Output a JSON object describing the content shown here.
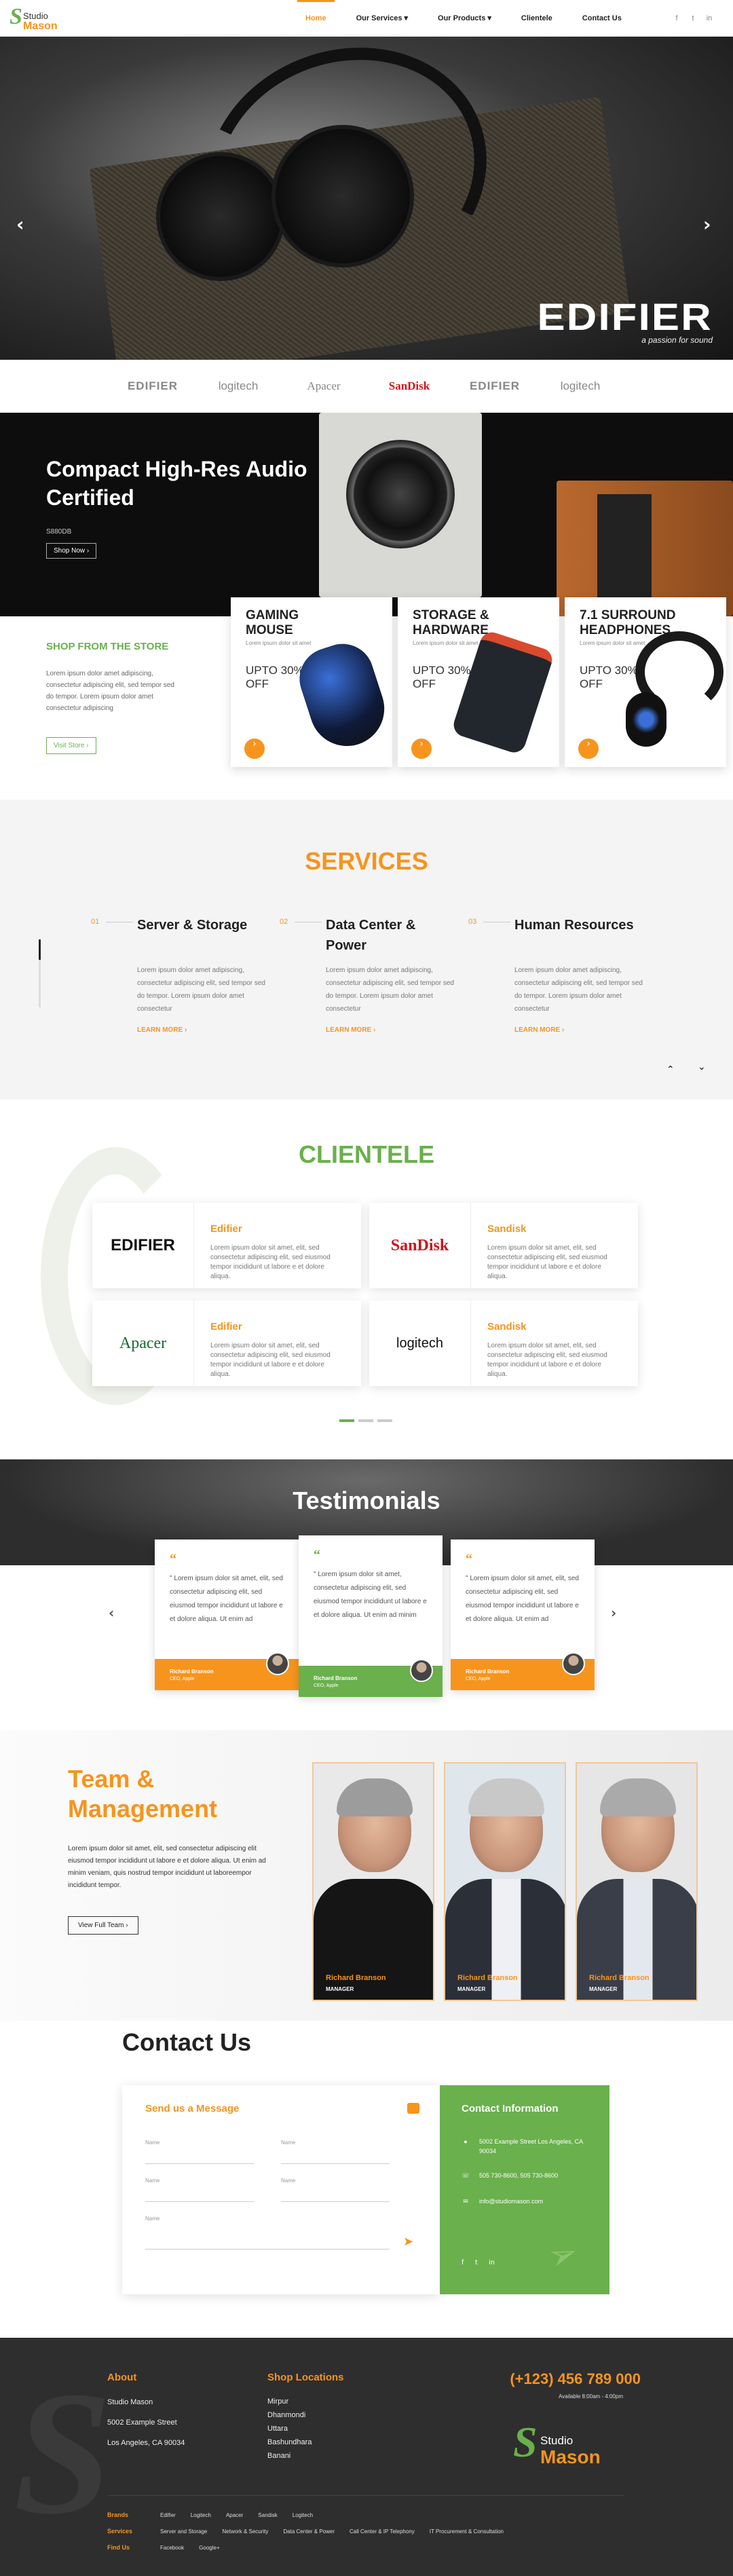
{
  "header": {
    "logo_line1": "Studio",
    "logo_line2": "Mason",
    "nav": [
      "Home",
      "Our Services",
      "Our Products",
      "Clientele",
      "Contact Us"
    ],
    "social_icons": [
      "facebook-icon",
      "twitter-icon",
      "linkedin-icon"
    ]
  },
  "hero": {
    "brand": "EDIFIER",
    "tagline": "a passion for sound",
    "prev_arrow": "‹",
    "next_arrow": "›"
  },
  "brand_strip": [
    "EDIFIER",
    "logitech",
    "Apacer",
    "SanDisk",
    "EDIFIER",
    "logitech"
  ],
  "banner": {
    "title": "Compact High-Res Audio Certified",
    "model": "S880DB",
    "button": "Shop Now"
  },
  "store": {
    "heading": "SHOP FROM THE STORE",
    "text": "Lorem ipsum dolor amet adipiscing, consectetur adipiscing elit, sed tempor sed do tempor. Lorem ipsum dolor amet consectetur adipiscing",
    "button": "Visit Store",
    "cards": [
      {
        "title": "GAMING MOUSE",
        "sub": "Lorem ipsum dolor sit amet",
        "offer": "UPTO 30% OFF"
      },
      {
        "title": "STORAGE & HARDWARE",
        "sub": "Lorem ipsum dolor sit amet",
        "offer": "UPTO 30% OFF"
      },
      {
        "title": "7.1 SURROUND HEADPHONES",
        "sub": "Lorem ipsum dolor sit amet",
        "offer": "UPTO 30% OFF"
      }
    ]
  },
  "services": {
    "title": "SERVICES",
    "items": [
      {
        "num": "01",
        "title": "Server & Storage",
        "text": "Lorem ipsum dolor amet adipiscing, consectetur adipiscing elit, sed tempor sed do tempor. Lorem ipsum dolor amet consectetur",
        "link": "LEARN MORE"
      },
      {
        "num": "02",
        "title": "Data Center & Power",
        "text": "Lorem ipsum dolor amet adipiscing, consectetur adipiscing elit, sed tempor sed do tempor. Lorem ipsum dolor amet consectetur",
        "link": "LEARN MORE"
      },
      {
        "num": "03",
        "title": "Human Resources",
        "text": "Lorem ipsum dolor amet adipiscing, consectetur adipiscing elit, sed tempor sed do tempor. Lorem ipsum dolor amet consectetur",
        "link": "LEARN MORE"
      }
    ]
  },
  "clientele": {
    "title": "CLIENTELE",
    "cards": [
      {
        "logo": "EDIFIER",
        "name": "Edifier",
        "text": "Lorem ipsum dolor sit amet, elit, sed consectetur adipiscing elit, sed eiusmod tempor incididunt ut labore e et dolore aliqua."
      },
      {
        "logo": "SanDisk",
        "name": "Sandisk",
        "text": "Lorem ipsum dolor sit amet, elit, sed consectetur adipiscing elit, sed eiusmod tempor incididunt ut labore e et dolore aliqua."
      },
      {
        "logo": "Apacer",
        "name": "Edifier",
        "text": "Lorem ipsum dolor sit amet, elit, sed consectetur adipiscing elit, sed eiusmod tempor incididunt ut labore e et dolore aliqua."
      },
      {
        "logo": "logitech",
        "name": "Sandisk",
        "text": "Lorem ipsum dolor sit amet, elit, sed consectetur adipiscing elit, sed eiusmod tempor incididunt ut labore e et dolore aliqua."
      }
    ]
  },
  "testimonials": {
    "title": "Testimonials",
    "items": [
      {
        "text": "\" Lorem ipsum dolor sit amet, elit, sed consectetur adipiscing elit, sed eiusmod tempor incididunt ut labore e et dolore aliqua. Ut enim ad",
        "name": "Richard Branson",
        "role": "CEO, Apple",
        "accent": "#f7941d"
      },
      {
        "text": "\" Lorem ipsum dolor sit amet, consectetur adipiscing elit, sed eiusmod tempor incididunt ut labore e et dolore aliqua. Ut enim ad minim",
        "name": "Richard Branson",
        "role": "CEO, Apple",
        "accent": "#6ab04c"
      },
      {
        "text": "\" Lorem ipsum dolor sit amet, elit, sed consectetur adipiscing elit, sed eiusmod tempor incididunt ut labore e et dolore aliqua. Ut enim ad",
        "name": "Richard Branson",
        "role": "CEO, Apple",
        "accent": "#f7941d"
      }
    ]
  },
  "team": {
    "title": "Team & Management",
    "text": "Lorem ipsum dolor sit amet, elit, sed consectetur adipiscing elit eiusmod tempor incididunt ut labore e et dolore aliqua. Ut enim ad minim veniam, quis nostrud tempor incididunt ut laboreempor incididunt tempor.",
    "button": "View Full Team",
    "members": [
      {
        "name": "Richard Branson",
        "role": "MANAGER"
      },
      {
        "name": "Richard Branson",
        "role": "MANAGER"
      },
      {
        "name": "Richard Branson",
        "role": "MANAGER"
      }
    ]
  },
  "contact": {
    "title": "Contact Us",
    "form_title": "Send us a Message",
    "fields": [
      "Name",
      "Name",
      "Name",
      "Name",
      "Name"
    ],
    "info_title": "Contact Information",
    "address": "5002 Example Street Los Angeles, CA 90034",
    "phone": "505 730-8600, 505 730-8600",
    "email": "info@studiomason.com"
  },
  "footer": {
    "about_title": "About",
    "about_lines": [
      "Studio Mason",
      "5002 Example Street",
      "Los Angeles, CA 90034"
    ],
    "locations_title": "Shop Locations",
    "locations": [
      "Mirpur",
      "Dhanmondi",
      "Uttara",
      "Bashundhara",
      "Banani"
    ],
    "phone": "(+123) 456 789 000",
    "available": "Available 8:00am - 4:00pm",
    "logo_line1": "Studio",
    "logo_line2": "Mason",
    "rows": [
      {
        "label": "Brands",
        "items": [
          "Edifier",
          "Logitech",
          "Apacer",
          "Sandisk",
          "Logitech"
        ]
      },
      {
        "label": "Services",
        "items": [
          "Server and Storage",
          "Network & Security",
          "Data Center & Power",
          "Call Center & IP Telephony",
          "IT Procurement & Consultation"
        ]
      },
      {
        "label": "Find Us",
        "items": [
          "Facebook",
          "Google+"
        ]
      }
    ]
  },
  "colors": {
    "orange": "#f7941d",
    "green": "#6ab04c",
    "dark": "#2e2e2e"
  }
}
